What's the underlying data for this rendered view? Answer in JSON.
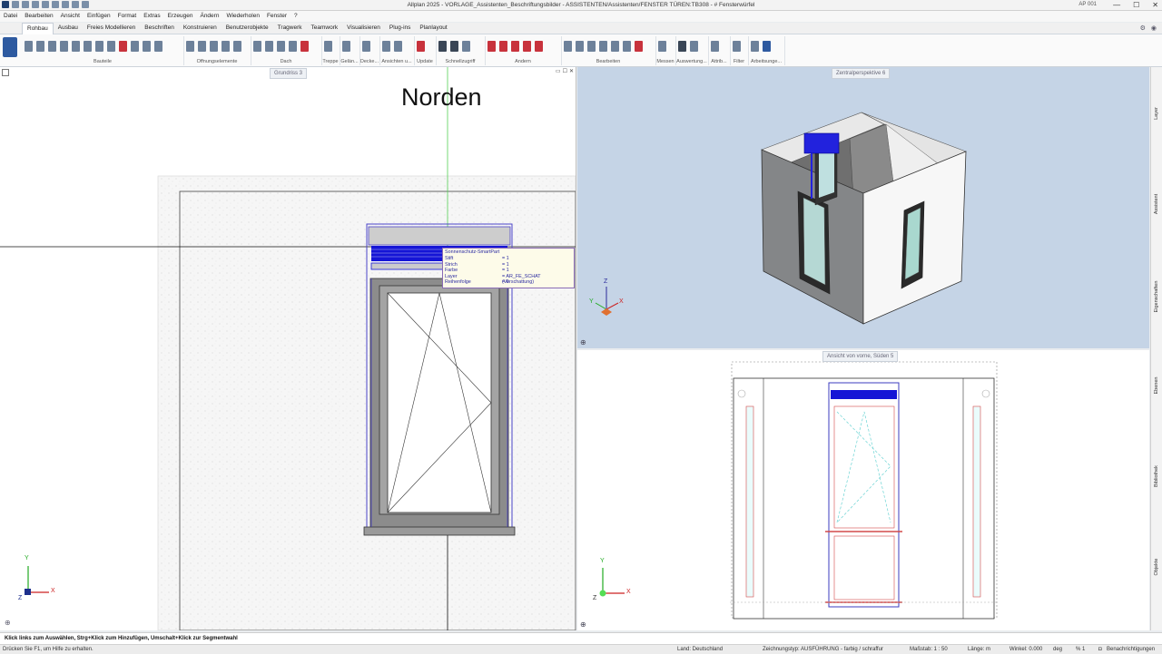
{
  "window": {
    "title": "Allplan 2025 - VORLAGE_Assistenten_Beschriftungsbilder - ASSISTENTEN/Assistenten/FENSTER TÜREN:TB308 - # Fensterwürfel",
    "user": "AP 001",
    "controls": {
      "minimize": "—",
      "maximize": "☐",
      "close": "✕"
    }
  },
  "menu": [
    "Datei",
    "Bearbeiten",
    "Ansicht",
    "Einfügen",
    "Format",
    "Extras",
    "Erzeugen",
    "Ändern",
    "Wiederholen",
    "Fenster",
    "?"
  ],
  "tabs": [
    "Rohbau",
    "Ausbau",
    "Freies Modellieren",
    "Beschriften",
    "Konstruieren",
    "Benutzerobjekte",
    "Tragwerk",
    "Teamwork",
    "Visualisieren",
    "Plug-ins",
    "Planlayout"
  ],
  "ribbon_groups": [
    "Bauteile",
    "Öffnungselemente",
    "Dach",
    "Treppe",
    "Gelän...",
    "Decke...",
    "Ansichten u...",
    "Update",
    "Schnellzugriff",
    "Ändern",
    "Bearbeiten",
    "Messen",
    "Auswertung...",
    "Attrib...",
    "Filter",
    "Arbeitsunge..."
  ],
  "viewports": {
    "plan": {
      "label": "Grundriss 3",
      "annotation": "Norden"
    },
    "perspective": {
      "label": "Zentralperspektive 6"
    },
    "elevation": {
      "label": "Ansicht von vorne, Süden 5"
    }
  },
  "tooltip": {
    "title": "Sonnenschutz-SmartPart",
    "rows": [
      {
        "key": "Stift",
        "value": "= 1"
      },
      {
        "key": "Strich",
        "value": "= 1"
      },
      {
        "key": "Farbe",
        "value": "= 1"
      },
      {
        "key": "Layer",
        "value": "= AR_FE_SCHAT (Verschattung)"
      },
      {
        "key": "Reihenfolge",
        "value": "= 0"
      }
    ]
  },
  "axes": {
    "x": "X",
    "y": "Y",
    "z": "Z"
  },
  "sidebar": [
    "Layer",
    "Assistent",
    "Eigenschaften",
    "Ebenen",
    "Bibliothek",
    "Objekte"
  ],
  "prompt": "Klick links zum Auswählen, Strg+Klick zum Hinzufügen, Umschalt+Klick zur Segmentwahl",
  "status": {
    "help": "Drücken Sie F1, um Hilfe zu erhalten.",
    "land": "Land:  Deutschland",
    "drawing_type": "Zeichnungstyp:  AUSFÜHRUNG - farbig / schraffur",
    "scale": "Maßstab:  1 : 50",
    "length": "Länge:  m",
    "angle": "Winkel:  0.000",
    "angle_unit": "deg",
    "percent": "%  1",
    "notifications": "Benachrichtigungen"
  },
  "colors": {
    "accent_blue": "#1515d6",
    "highlight_red": "#d24a4a",
    "view_3d_bg": "#c5d4e6",
    "axis_green": "#22aa22"
  }
}
